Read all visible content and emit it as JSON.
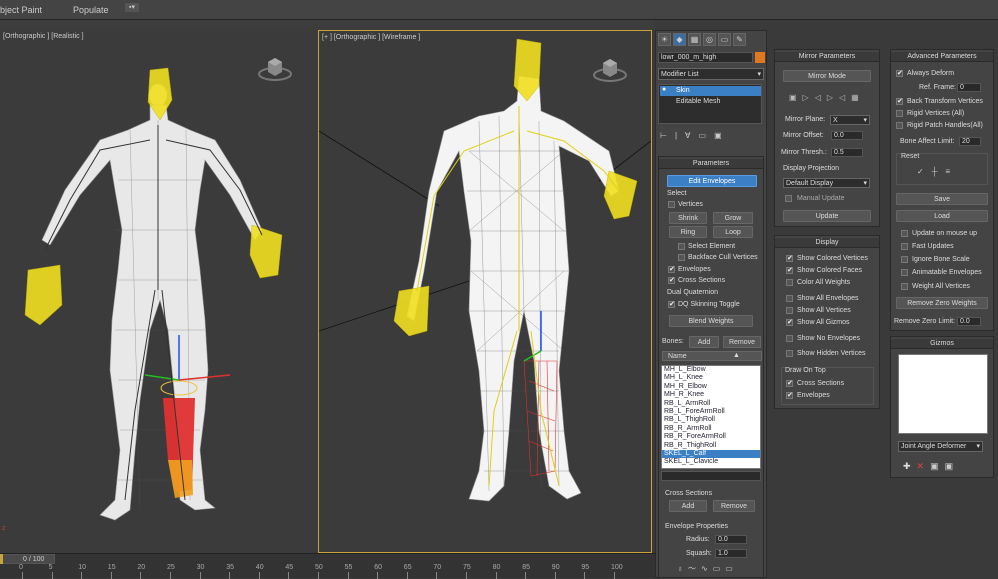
{
  "menubar": {
    "item1": "bject Paint",
    "item2": "Populate"
  },
  "viewport_left": {
    "label": "[Orthographic ] [Realistic ]"
  },
  "viewport_right": {
    "label": "[+ ] [Orthographic ] [Wireframe ]"
  },
  "timeline": {
    "frame": "0 / 100",
    "ticks": [
      "0",
      "5",
      "10",
      "15",
      "20",
      "25",
      "30",
      "35",
      "40",
      "45",
      "50",
      "55",
      "60",
      "65",
      "70",
      "75",
      "80",
      "85",
      "90",
      "95",
      "100"
    ]
  },
  "modify": {
    "object_name": "lowr_000_m_high",
    "modifier_list": "Modifier List",
    "stack": [
      "Skin",
      "Editable Mesh"
    ],
    "parameters": {
      "title": "Parameters",
      "edit_envelopes": "Edit Envelopes",
      "select_group": "Select",
      "vertices": "Vertices",
      "shrink": "Shrink",
      "grow": "Grow",
      "ring": "Ring",
      "loop": "Loop",
      "select_element": "Select Element",
      "backface_cull": "Backface Cull Vertices",
      "envelopes": "Envelopes",
      "cross_sections": "Cross Sections",
      "dual_quaternion": "Dual Quaternion",
      "dq_toggle": "DQ Skinning Toggle",
      "blend_weights": "Blend Weights",
      "bones_label": "Bones:",
      "add": "Add",
      "remove": "Remove",
      "name_header": "Name",
      "bones": [
        "MH_L_Elbow",
        "MH_L_Knee",
        "MH_R_Elbow",
        "MH_R_Knee",
        "RB_L_ArmRoll",
        "RB_L_ForeArmRoll",
        "RB_L_ThighRoll",
        "RB_R_ArmRoll",
        "RB_R_ForeArmRoll",
        "RB_R_ThighRoll",
        "SKEL_L_Calf",
        "SKEL_L_Clavicle"
      ],
      "cross_sections_title": "Cross Sections",
      "cs_add": "Add",
      "cs_remove": "Remove",
      "envelope_properties": "Envelope Properties",
      "radius_label": "Radius:",
      "radius_value": "0.0",
      "squash_label": "Squash:",
      "squash_value": "1.0"
    }
  },
  "mirror": {
    "title": "Mirror Parameters",
    "mirror_mode": "Mirror Mode",
    "mirror_plane_label": "Mirror Plane:",
    "mirror_plane_value": "X",
    "mirror_offset_label": "Mirror Offset:",
    "mirror_offset_value": "0.0",
    "mirror_thresh_label": "Mirror Thresh.:",
    "mirror_thresh_value": "0.5",
    "display_projection": "Display Projection",
    "projection_value": "Default Display",
    "manual_update": "Manual Update",
    "update": "Update"
  },
  "display": {
    "title": "Display",
    "items": [
      "Show Colored Vertices",
      "Show Colored Faces",
      "Color All Weights",
      "Show All Envelopes",
      "Show All Vertices",
      "Show All Gizmos",
      "Show No Envelopes",
      "Show Hidden Vertices"
    ],
    "draw_on_top": "Draw On Top",
    "dot_items": [
      "Cross Sections",
      "Envelopes"
    ]
  },
  "advanced": {
    "title": "Advanced Parameters",
    "always_deform": "Always Deform",
    "ref_frame_label": "Ref. Frame:",
    "ref_frame_value": "0",
    "back_transform": "Back Transform Vertices",
    "rigid_vertices": "Rigid Vertices (All)",
    "rigid_patch": "Rigid Patch Handles(All)",
    "bone_affect_label": "Bone Affect Limit:",
    "bone_affect_value": "20",
    "reset": "Reset",
    "save": "Save",
    "load": "Load",
    "update_on_mouse": "Update on mouse up",
    "fast_updates": "Fast Updates",
    "ignore_bone_scale": "Ignore Bone Scale",
    "animatable_envelopes": "Animatable Envelopes",
    "weight_all_vertices": "Weight All Vertices",
    "remove_zero_weights": "Remove Zero Weights",
    "remove_zero_limit_label": "Remove Zero Limit:",
    "remove_zero_limit_value": "0.0"
  },
  "gizmos": {
    "title": "Gizmos",
    "deformer": "Joint Angle Deformer"
  }
}
